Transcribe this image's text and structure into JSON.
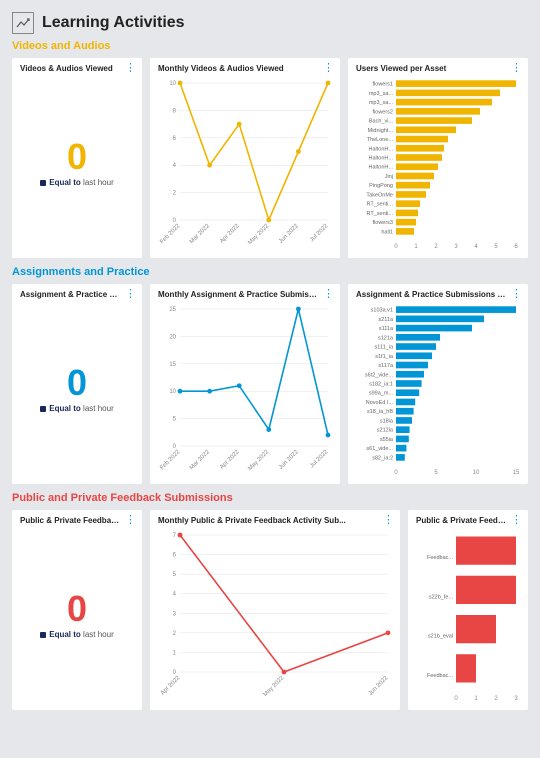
{
  "page_title": "Learning Activities",
  "colors": {
    "videos": "#f0b500",
    "assignments": "#0296d6",
    "feedback": "#e84545"
  },
  "sections": [
    {
      "title": "Videos and Audios",
      "color": "#f0b500",
      "metric": {
        "title": "Videos & Audios Viewed",
        "value": "0",
        "equal_to": "Equal to",
        "period": "last hour"
      },
      "line": {
        "title": "Monthly Videos & Audios Viewed"
      },
      "bars": {
        "title": "Users Viewed per Asset"
      }
    },
    {
      "title": "Assignments and Practice",
      "color": "#0296d6",
      "metric": {
        "title": "Assignment & Practice Sub...",
        "value": "0",
        "equal_to": "Equal to",
        "period": "last hour"
      },
      "line": {
        "title": "Monthly Assignment & Practice Submissions"
      },
      "bars": {
        "title": "Assignment & Practice Submissions per Activity"
      }
    },
    {
      "title": "Public and Private Feedback Submissions",
      "color": "#e84545",
      "metric": {
        "title": "Public & Private Feedback ...",
        "value": "0",
        "equal_to": "Equal to",
        "period": "last hour"
      },
      "line": {
        "title": "Monthly Public & Private Feedback Activity Sub..."
      },
      "bars": {
        "title": "Public & Private Feedback Submissions per Activ..."
      }
    }
  ],
  "chart_data": [
    {
      "type": "line",
      "title": "Monthly Videos & Audios Viewed",
      "xlabel": "",
      "ylabel": "",
      "ylim": [
        0,
        10
      ],
      "yticks": [
        0,
        2,
        4,
        6,
        8,
        10
      ],
      "categories": [
        "Feb 2022",
        "Mar 2022",
        "Apr 2022",
        "May 2022",
        "Jun 2022",
        "Jul 2022"
      ],
      "values": [
        10,
        4,
        7,
        0,
        5,
        10
      ],
      "color": "#f0b500"
    },
    {
      "type": "bar",
      "orientation": "horizontal",
      "title": "Users Viewed per Asset",
      "xlim": [
        0,
        6
      ],
      "xticks": [
        0,
        1,
        2,
        3,
        4,
        5,
        6
      ],
      "categories": [
        "flowers1",
        "mp3_sa...",
        "mp3_sa...",
        "flowers2",
        "Bach_vi...",
        "Midnight...",
        "TheLone...",
        "HaltonH...",
        "HaltonH...",
        "HaltonH...",
        "Jinj",
        "PingPong",
        "TakeOnMe",
        "RT_senti...",
        "RT_senti...",
        "flowers3",
        "hall1"
      ],
      "values": [
        6,
        5.2,
        4.8,
        4.2,
        3.8,
        3.0,
        2.6,
        2.4,
        2.3,
        2.1,
        1.9,
        1.7,
        1.5,
        1.2,
        1.1,
        1.0,
        0.9
      ],
      "color": "#f0b500"
    },
    {
      "type": "line",
      "title": "Monthly Assignment & Practice Submissions",
      "ylim": [
        0,
        25
      ],
      "yticks": [
        0,
        5,
        10,
        15,
        20,
        25
      ],
      "categories": [
        "Feb 2022",
        "Mar 2022",
        "Apr 2022",
        "May 2022",
        "Jun 2022",
        "Jul 2022"
      ],
      "values": [
        10,
        10,
        11,
        3,
        25,
        2
      ],
      "color": "#0296d6"
    },
    {
      "type": "bar",
      "orientation": "horizontal",
      "title": "Assignment & Practice Submissions per Activity",
      "xlim": [
        0,
        15
      ],
      "xticks": [
        0,
        5,
        10,
        15
      ],
      "categories": [
        "s103a.v1",
        "s211a",
        "s111a",
        "s121a",
        "s111_ia",
        "s1f1_ia",
        "s117a",
        "s6t2_vide...",
        "s182_ia:1",
        "s99a_m...",
        "NovoEd I...",
        "s18_ia_hB",
        "s18ia",
        "s212ia",
        "s55ia",
        "s61_vide...",
        "s82_ia:2"
      ],
      "values": [
        15,
        11,
        9.5,
        5.5,
        5,
        4.5,
        4,
        3.5,
        3.2,
        2.9,
        2.4,
        2.2,
        2.0,
        1.7,
        1.6,
        1.3,
        1.1
      ],
      "color": "#0296d6"
    },
    {
      "type": "line",
      "title": "Monthly Public & Private Feedback Activity Submissions",
      "ylim": [
        0,
        7
      ],
      "yticks": [
        0,
        1,
        2,
        3,
        4,
        5,
        6,
        7
      ],
      "categories": [
        "Apr 2022",
        "May 2022",
        "Jun 2022"
      ],
      "values": [
        7,
        0,
        2
      ],
      "color": "#e84545"
    },
    {
      "type": "bar",
      "orientation": "horizontal",
      "title": "Public & Private Feedback Submissions per Activity",
      "xlim": [
        0,
        3
      ],
      "xticks": [
        0,
        1,
        2,
        3
      ],
      "categories": [
        "Feedbac...",
        "s22b_fe...",
        "s21b_eval",
        "Feedbac..."
      ],
      "values": [
        3,
        3,
        2,
        1
      ],
      "color": "#e84545"
    }
  ]
}
